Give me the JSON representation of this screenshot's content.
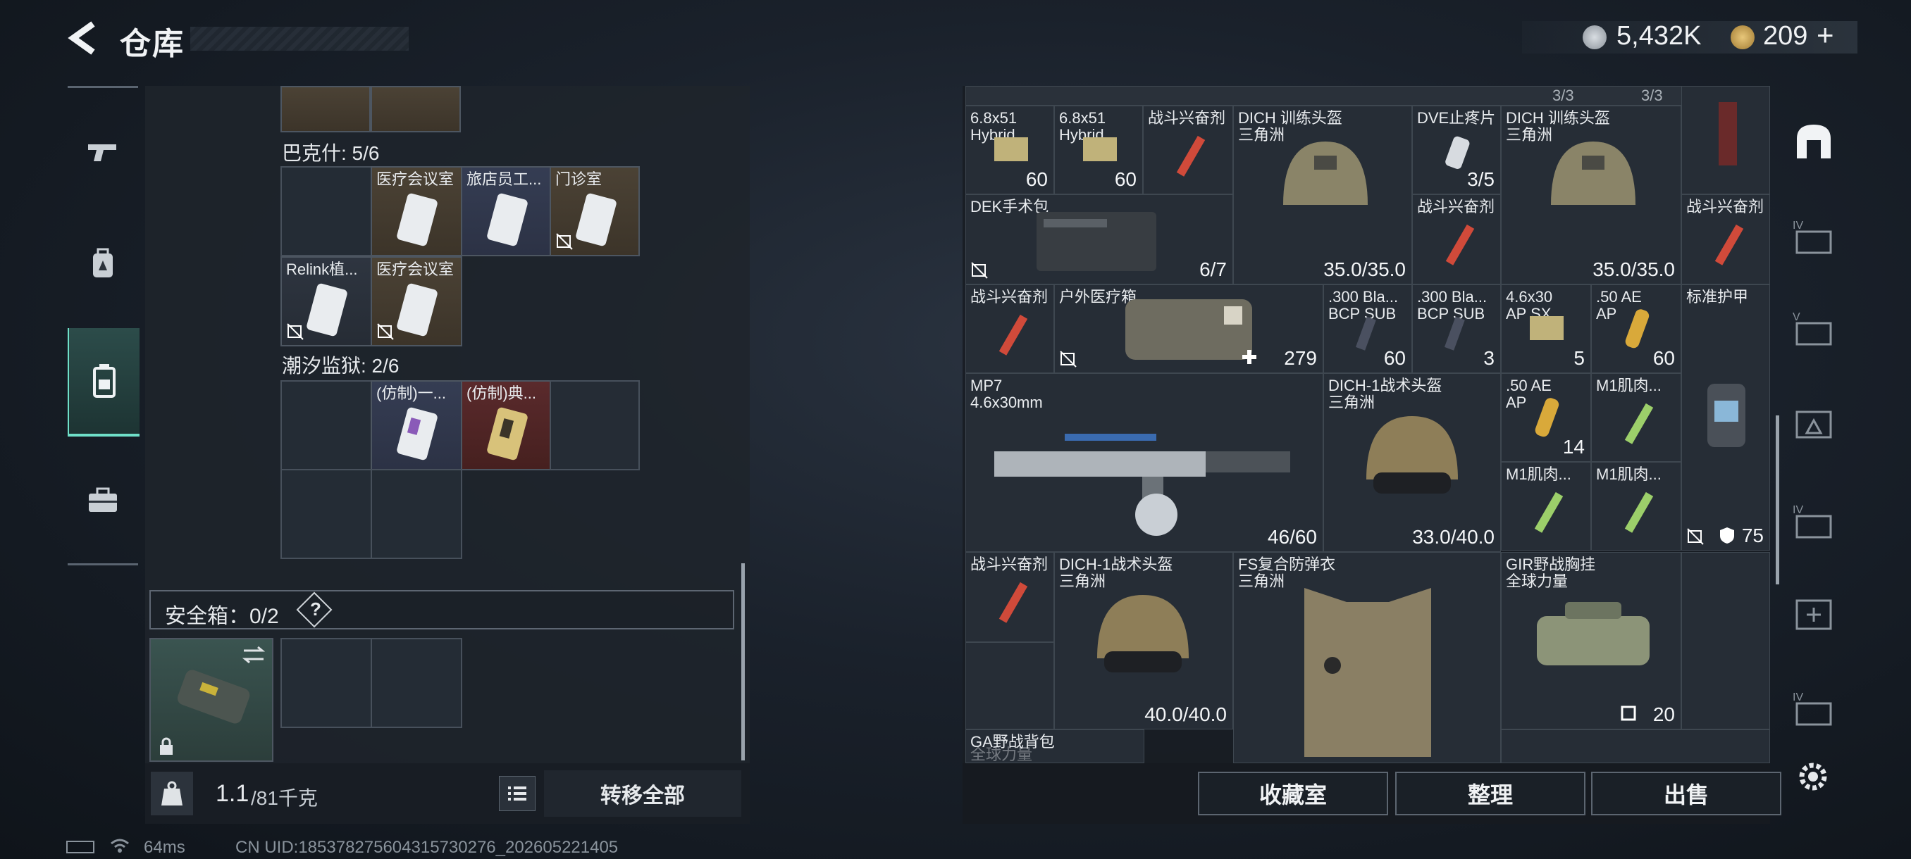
{
  "header": {
    "title": "仓库",
    "silver": "5,432K",
    "gold": "209",
    "plus": "+"
  },
  "left_nav": [
    "gun-icon",
    "backpack-icon",
    "container-icon",
    "briefcase-icon"
  ],
  "left_panel": {
    "section1": "巴克什: 5/6",
    "section2": "潮汐监狱: 2/6",
    "items_s1": [
      "医疗会议室",
      "旅店员工...",
      "门诊室",
      "Relink植...",
      "医疗会议室"
    ],
    "items_s2": [
      "(仿制)一...",
      "(仿制)典..."
    ],
    "safe_box": "安全箱：0/2",
    "help": "?",
    "weight_value": "1.1",
    "weight_max": "/81千克",
    "transfer_all": "转移全部"
  },
  "right_panel": {
    "top_partial": [
      "3/3",
      "3/3"
    ],
    "items": {
      "ammo1": {
        "line1": "6.8x51",
        "line2": "Hybrid",
        "count": "60"
      },
      "ammo2": {
        "line1": "6.8x51",
        "line2": "Hybrid",
        "count": "60"
      },
      "stim1": "战斗兴奋剂",
      "helmet1": {
        "name": "DICH 训练头盔",
        "brand": "三角洲",
        "dur": "35.0/35.0"
      },
      "dve": {
        "name": "DVE止疼片",
        "count": "3/5"
      },
      "helmet2": {
        "name": "DICH 训练头盔",
        "brand": "三角洲",
        "dur": "35.0/35.0"
      },
      "dek": {
        "name": "DEK手术包",
        "count": "6/7"
      },
      "stim2": "战斗兴奋剂",
      "stim3": "战斗兴奋剂",
      "stim4": "战斗兴奋剂",
      "outdoor": {
        "name": "户外医疗箱",
        "count": "279"
      },
      "ammo3": {
        "line1": ".300 Bla...",
        "line2": "BCP SUB",
        "count": "60"
      },
      "ammo4": {
        "line1": ".300 Bla...",
        "line2": "BCP SUB",
        "count": "3"
      },
      "ammo5": {
        "line1": "4.6x30",
        "line2": "AP SX",
        "count": "5"
      },
      "ammo6": {
        "line1": ".50 AE",
        "line2": "AP",
        "count": "60"
      },
      "armor_std": {
        "name": "标准护甲",
        "value": "75"
      },
      "mp7": {
        "name": "MP7",
        "cal": "4.6x30mm",
        "ammo": "46/60"
      },
      "helmet3": {
        "name": "DICH-1战术头盔",
        "brand": "三角洲",
        "dur": "33.0/40.0"
      },
      "ammo7": {
        "line1": ".50 AE",
        "line2": "AP",
        "count": "14"
      },
      "m1a": "M1肌肉...",
      "m1b": "M1肌肉...",
      "m1c": "M1肌肉...",
      "stim5": "战斗兴奋剂",
      "helmet4": {
        "name": "DICH-1战术头盔",
        "brand": "三角洲",
        "dur": "40.0/40.0"
      },
      "vest": {
        "name": "FS复合防弹衣",
        "brand": "三角洲"
      },
      "rig": {
        "name": "GIR野战胸挂",
        "brand": "全球力量",
        "value": "20"
      },
      "backpack": {
        "name": "GA野战背包",
        "brand": "全球力量"
      }
    },
    "buttons": {
      "collection": "收藏室",
      "sort": "整理",
      "sell": "出售"
    }
  },
  "footer": {
    "ping": "64ms",
    "uid": "CN UID:1853782756043157302​76_202605221405"
  }
}
